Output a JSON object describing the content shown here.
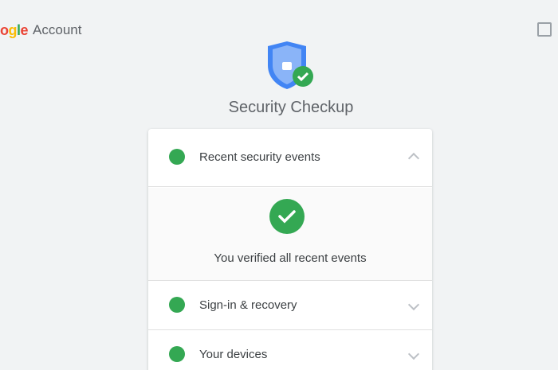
{
  "header": {
    "logo_letters": [
      "o",
      "g",
      "l",
      "e"
    ],
    "logo_colors": [
      "#ea4335",
      "#fbbc05",
      "#34a853",
      "#ea4335"
    ],
    "product_name": "Account"
  },
  "hero": {
    "icon": "shield-check-icon",
    "title": "Security Checkup"
  },
  "checkup": {
    "items": [
      {
        "label": "Recent security events",
        "status": "ok"
      },
      {
        "label": "Sign-in & recovery",
        "status": "ok"
      },
      {
        "label": "Your devices",
        "status": "ok"
      }
    ],
    "expanded_message": "You verified all recent events"
  },
  "colors": {
    "success": "#34a853",
    "shield_blue": "#4285f4"
  }
}
